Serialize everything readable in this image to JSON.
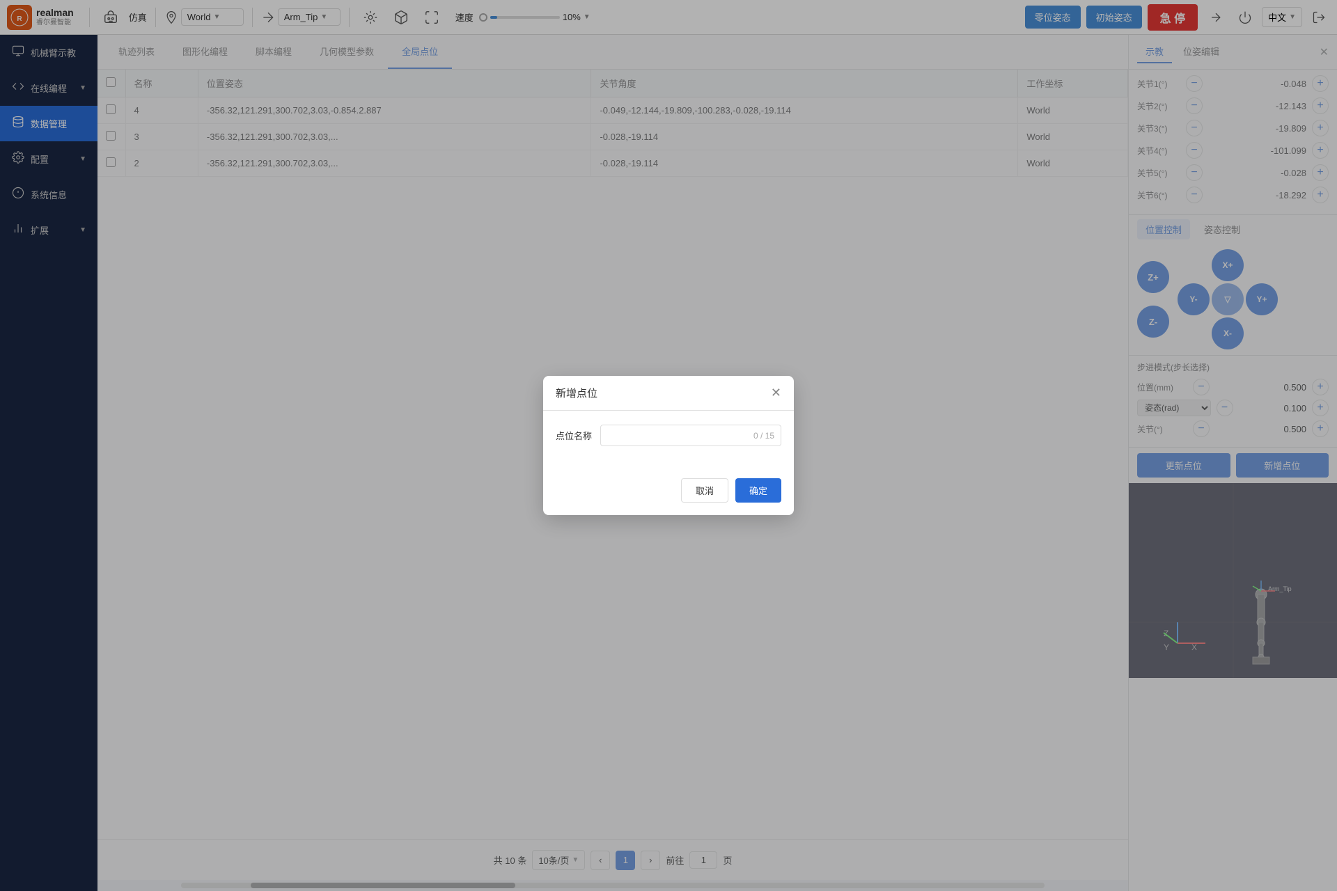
{
  "app": {
    "name": "realman",
    "name_cn": "睿尔曼智能"
  },
  "topbar": {
    "simulation_label": "仿真",
    "world_label": "World",
    "arm_label": "Arm_Tip",
    "speed_label": "速度",
    "speed_value": "10%",
    "btn_zero": "零位姿态",
    "btn_init": "初始姿态",
    "btn_emergency": "急 停",
    "lang_label": "中文",
    "icons": {
      "robot": "🤖",
      "settings": "⚙",
      "waypoint": "📍",
      "network": "🔗",
      "cube": "⬡",
      "arrow_expand": "⬌"
    }
  },
  "sidebar": {
    "items": [
      {
        "label": "机械臂示教",
        "icon": "🦾",
        "active": false
      },
      {
        "label": "在线编程",
        "icon": "💻",
        "active": false,
        "expand": true
      },
      {
        "label": "数据管理",
        "icon": "📊",
        "active": true
      },
      {
        "label": "配置",
        "icon": "⚙",
        "active": false,
        "expand": true
      },
      {
        "label": "系统信息",
        "icon": "ℹ",
        "active": false
      },
      {
        "label": "扩展",
        "icon": "🔌",
        "active": false,
        "expand": true
      }
    ]
  },
  "tabs": [
    {
      "label": "轨迹列表",
      "active": false
    },
    {
      "label": "图形化编程",
      "active": false
    },
    {
      "label": "脚本编程",
      "active": false
    },
    {
      "label": "几何模型参数",
      "active": false
    },
    {
      "label": "全局点位",
      "active": true
    }
  ],
  "table": {
    "headers": [
      "",
      "名称",
      "位置姿态",
      "关节角度",
      "工作坐标"
    ],
    "rows": [
      {
        "id": "4",
        "position": "-356.32,121.291,300.702,3.03,-0.854.2.887",
        "joints": "-0.049,-12.144,-19.809,-100.283,-0.028,-19.114",
        "coord": "World"
      },
      {
        "id": "3",
        "position": "-356.32,121.291,300.702,3.03,...",
        "joints": "-0.028,-19.114",
        "coord": "World"
      },
      {
        "id": "2",
        "position": "-356.32,121.291,300.702,3.03,...",
        "joints": "-0.028,-19.114",
        "coord": "World"
      }
    ]
  },
  "pagination": {
    "total_label": "共 10 条",
    "page_size": "10条/页",
    "current_page": "1",
    "prev_label": "‹",
    "next_label": "›",
    "goto_label": "前往",
    "page_unit": "页"
  },
  "right_panel": {
    "tab_show": "示教",
    "tab_position_editor": "位姿编辑",
    "joints": [
      {
        "label": "关节1(°)",
        "value": "-0.048"
      },
      {
        "label": "关节2(°)",
        "value": "-12.143"
      },
      {
        "label": "关节3(°)",
        "value": "-19.809"
      },
      {
        "label": "关节4(°)",
        "value": "-101.099"
      },
      {
        "label": "关节5(°)",
        "value": "-0.028"
      },
      {
        "label": "关节6(°)",
        "value": "-18.292"
      }
    ],
    "ctrl_tab_position": "位置控制",
    "ctrl_tab_pose": "姿态控制",
    "directions": {
      "x_plus": "X+",
      "x_minus": "X-",
      "y_plus": "Y+",
      "y_minus": "Y-",
      "z_plus": "Z+",
      "z_minus": "Z-"
    },
    "step_title": "步进模式(步长选择)",
    "step_position_label": "位置(mm)",
    "step_position_value": "0.500",
    "step_pose_label": "姿态(rad)",
    "step_pose_value": "0.100",
    "step_joint_label": "关节(°)",
    "step_joint_value": "0.500",
    "btn_update": "更新点位",
    "btn_add": "新增点位"
  },
  "modal": {
    "title": "新增点位",
    "field_label": "点位名称",
    "placeholder": "",
    "counter": "0 / 15",
    "btn_cancel": "取消",
    "btn_confirm": "确定"
  }
}
